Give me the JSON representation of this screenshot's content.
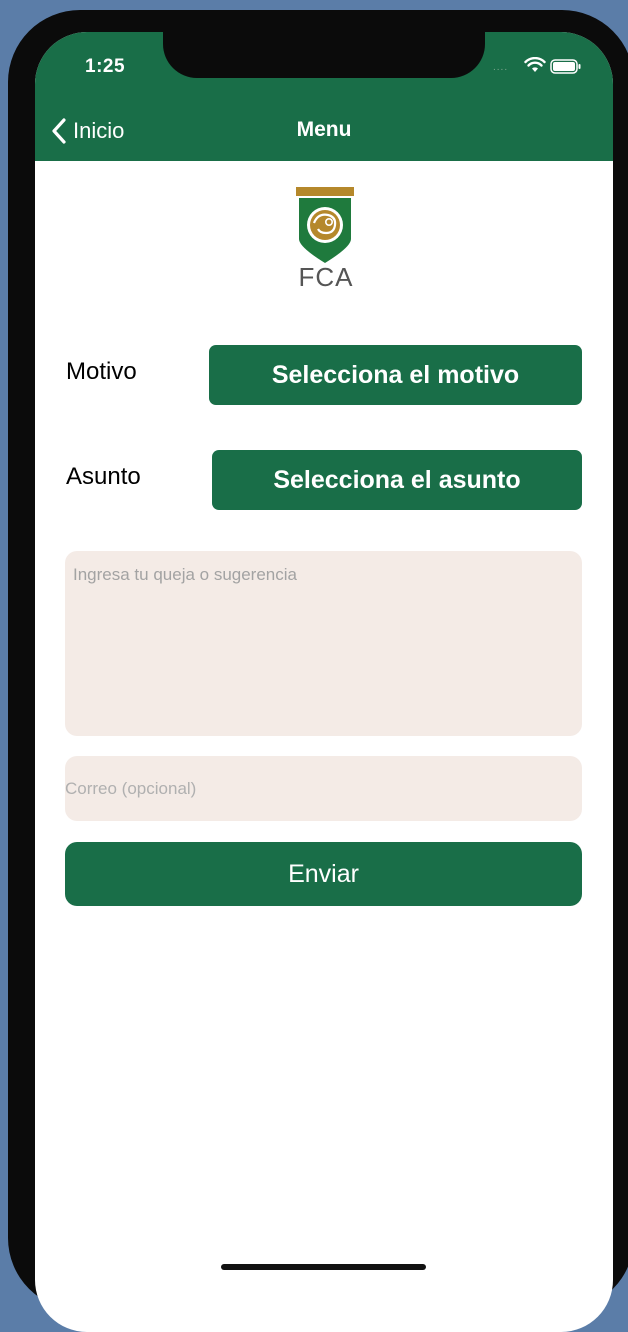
{
  "status_bar": {
    "time": "1:25",
    "dots": "....",
    "wifi_icon": "wifi-icon",
    "battery_icon": "battery-icon"
  },
  "nav": {
    "back_label": "Inicio",
    "title": "Menu",
    "back_icon": "chevron-left-icon"
  },
  "logo": {
    "text": "FCA",
    "colors": {
      "gold": "#b5882b",
      "green": "#1f7a3d"
    }
  },
  "form": {
    "motivo_label": "Motivo",
    "motivo_button": "Selecciona el motivo",
    "asunto_label": "Asunto",
    "asunto_button": "Selecciona el asunto",
    "complaint_placeholder": "Ingresa tu queja o sugerencia",
    "email_placeholder": "Correo (opcional)",
    "submit_label": "Enviar"
  },
  "colors": {
    "primary": "#196e48",
    "field_bg": "#f4ebe6"
  }
}
